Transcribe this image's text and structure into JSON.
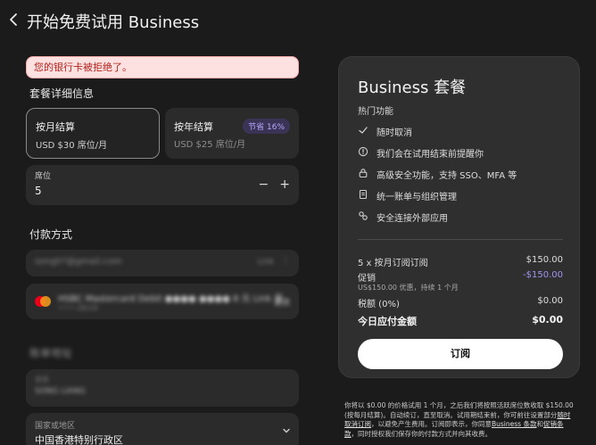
{
  "header": {
    "title": "开始免费试用 Business"
  },
  "alert": {
    "message": "您的银行卡被拒绝了。"
  },
  "plan_details": {
    "title": "套餐详细信息",
    "monthly": {
      "name": "按月结算",
      "price": "USD $30 席位/月"
    },
    "yearly": {
      "name": "按年结算",
      "price": "USD $25 席位/月",
      "badge": "节省 16%"
    },
    "seats": {
      "label": "席位",
      "value": "5",
      "decrement": "−",
      "increment": "+"
    }
  },
  "payment": {
    "title": "付款方式",
    "email": "songh*@gmail.com",
    "email_tag": "Link",
    "card_name": "HSBC Mastercard Debit ●●●● ●●●● 8 元 Link 号",
    "card_expiry": "•••• 08/28",
    "card_edit": "更改"
  },
  "billing": {
    "title": "账单地址",
    "name_label": "全名",
    "name_value": "SONG LIANG",
    "region_label": "国家或地区",
    "region_value": "中国香港特别行政区"
  },
  "summary": {
    "title": "Business 套餐",
    "features_title": "热门功能",
    "features": [
      {
        "icon": "check-icon",
        "text": "随时取消"
      },
      {
        "icon": "bell-icon",
        "text": "我们会在试用结束前提醒你"
      },
      {
        "icon": "lock-icon",
        "text": "高级安全功能，支持 SSO、MFA 等"
      },
      {
        "icon": "document-icon",
        "text": "统一账单与组织管理"
      },
      {
        "icon": "link-icon",
        "text": "安全连接外部应用"
      }
    ],
    "line_label": "5 x 按月订阅订阅",
    "line_value": "$150.00",
    "discount_label": "促销",
    "discount_value": "-$150.00",
    "discount_note": "US$150.00 优惠，持续 1 个月",
    "tax_label": "税额 (0%)",
    "tax_value": "$0.00",
    "total_label": "今日应付金额",
    "total_value": "$0.00",
    "subscribe_label": "订阅"
  },
  "footnote": {
    "text_1": "你将以 $0.00 的价格试用 1 个月，之后我们将按照活跃席位数收取 $150.00 (按每月结算)。自动续订，直至取消。试用期结束前，你可前往设置部分",
    "link_1": "随时取消订阅",
    "text_2": "，以避免产生费用。订阅即表示，你同意",
    "link_2": "Business 条款",
    "text_3": "和",
    "link_3": "促销条款",
    "text_4": "，同时授权我们保存你的付款方式并向其收费。"
  },
  "colors": {
    "accent": "#9f95f0",
    "alert_bg": "#fde0e0",
    "alert_text": "#b4231d"
  }
}
